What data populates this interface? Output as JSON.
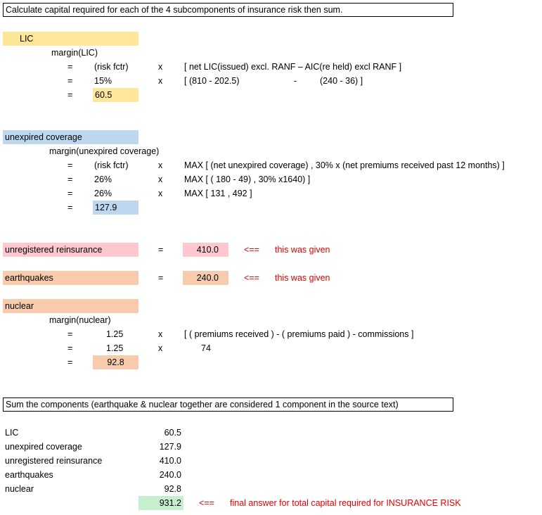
{
  "title_box": "Calculate capital required for each of the 4 subcomponents of insurance risk then sum.",
  "lic": {
    "header": "LIC",
    "margin_label": "margin(LIC)",
    "row1": {
      "eq": "=",
      "factor": "(risk fctr)",
      "op": "x",
      "expr": "[ net LIC(issued) excl. RANF  –  AIC(re held) excl RANF ]"
    },
    "row2": {
      "eq": "=",
      "factor": "15%",
      "op": "x",
      "expr_a": "[ (810 - 202.5)",
      "dash": "-",
      "expr_b": "(240 - 36) ]"
    },
    "row3": {
      "eq": "=",
      "value": "60.5"
    }
  },
  "unexpired": {
    "header": "unexpired coverage",
    "margin_label": "margin(unexpired coverage)",
    "row1": {
      "eq": "=",
      "factor": "(risk fctr)",
      "op": "x",
      "expr": "MAX [ (net unexpired coverage) , 30% x (net premiums received past 12 months) ]"
    },
    "row2": {
      "eq": "=",
      "factor": "26%",
      "op": "x",
      "expr": "MAX [ ( 180 - 49) , 30% x1640) ]"
    },
    "row3": {
      "eq": "=",
      "factor": "26%",
      "op": "x",
      "expr": "MAX [ 131 , 492 ]"
    },
    "row4": {
      "eq": "=",
      "value": "127.9"
    }
  },
  "unregistered": {
    "label": "unregistered reinsurance",
    "eq": "=",
    "value": "410.0",
    "arrow": "<==",
    "note": "this was given"
  },
  "earthquakes": {
    "label": "earthquakes",
    "eq": "=",
    "value": "240.0",
    "arrow": "<==",
    "note": "this was given"
  },
  "nuclear": {
    "header": "nuclear",
    "margin_label": "margin(nuclear)",
    "row1": {
      "eq": "=",
      "factor": "1.25",
      "op": "x",
      "expr": "[ ( premiums received ) - ( premiums paid ) - commissions ]"
    },
    "row2": {
      "eq": "=",
      "factor": "1.25",
      "op": "x",
      "expr": "74"
    },
    "row3": {
      "eq": "=",
      "value": "92.8"
    }
  },
  "sum_box": "Sum the components (earthquake & nuclear together are considered 1 component in the source text)",
  "summary": {
    "rows": [
      {
        "label": "LIC",
        "value": "60.5"
      },
      {
        "label": "unexpired coverage",
        "value": "127.9"
      },
      {
        "label": "unregistered reinsurance",
        "value": "410.0"
      },
      {
        "label": "earthquakes",
        "value": "240.0"
      },
      {
        "label": "nuclear",
        "value": "92.8"
      }
    ],
    "total": "931.2",
    "arrow": "<==",
    "note": "final answer for total capital required for INSURANCE RISK"
  },
  "colors": {
    "yellow": "#FFE699",
    "blue": "#BDD7EE",
    "pink": "#FFC7CE",
    "orange": "#F8CBAD",
    "green": "#C6EFCE",
    "red": "#E00000"
  }
}
